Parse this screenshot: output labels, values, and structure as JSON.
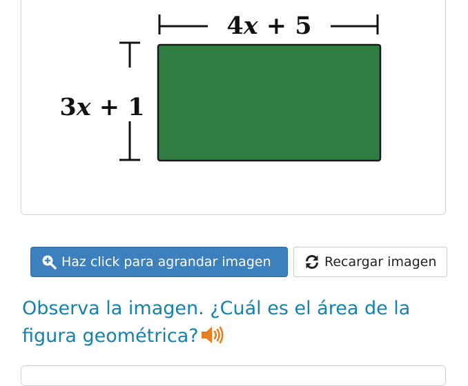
{
  "figure": {
    "width_label": "4x + 5",
    "width_label_parts": {
      "coef": "4",
      "var": "x",
      "rest": " + 5"
    },
    "height_label": "3x + 1",
    "height_label_parts": {
      "coef": "3",
      "var": "x",
      "rest": " + 1"
    },
    "shape": "rectangle",
    "fill_color": "#2f7d43",
    "stroke_color": "#1a1a1a"
  },
  "buttons": {
    "zoom_label": "Haz click para agrandar imagen",
    "zoom_icon": "zoom-in-icon",
    "reload_label": "Recargar imagen",
    "reload_icon": "refresh-icon"
  },
  "question": {
    "text": "Observa la imagen. ¿Cuál es el área de la figura geométrica?",
    "speaker_icon": "speaker-icon"
  },
  "colors": {
    "primary_button": "#3c80bd",
    "question_text": "#1581ad",
    "speaker": "#e67e22"
  }
}
